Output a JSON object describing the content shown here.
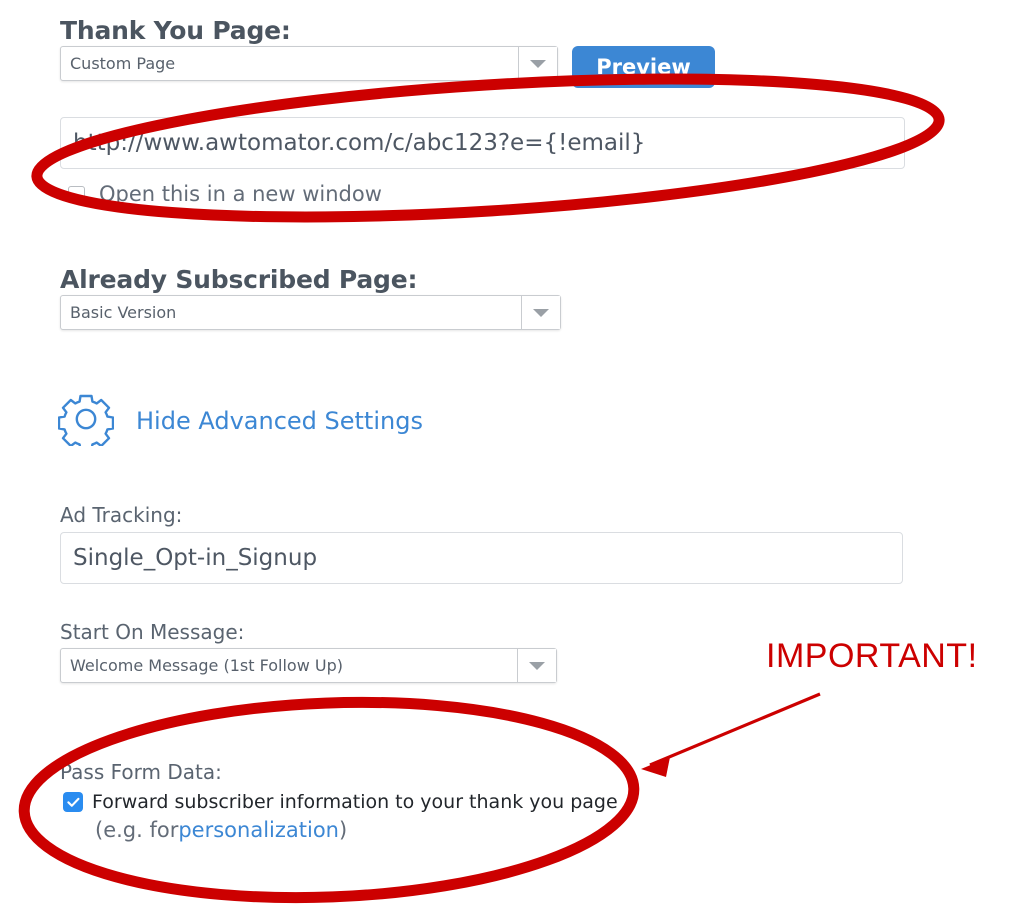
{
  "form": {
    "thank_you": {
      "heading": "Thank You Page:",
      "select_value": "Custom Page",
      "preview_button": "Preview",
      "url_value": "http://www.awtomator.com/c/abc123?e={!email}",
      "new_window_label": "Open this in a new window",
      "new_window_checked": false
    },
    "already_subscribed": {
      "heading": "Already Subscribed Page:",
      "select_value": "Basic Version"
    },
    "advanced_toggle": {
      "label": "Hide Advanced Settings",
      "icon": "gear-icon"
    },
    "ad_tracking": {
      "label": "Ad Tracking:",
      "value": "Single_Opt-in_Signup"
    },
    "start_on_message": {
      "label": "Start On Message:",
      "select_value": "Welcome Message (1st Follow Up)"
    },
    "pass_form_data": {
      "label": "Pass Form Data:",
      "checkbox_label": "Forward subscriber information to your thank you page",
      "checked": true,
      "note_prefix": "(e.g. for ",
      "note_link": "personalization",
      "note_suffix": ")"
    }
  },
  "annotations": {
    "important_text": "IMPORTANT!",
    "color": "#cc0000"
  },
  "colors": {
    "accent_blue": "#3c87d4",
    "checkbox_blue": "#2a8cf0",
    "heading_gray": "#4b5560",
    "annotation_red": "#cc0000"
  }
}
